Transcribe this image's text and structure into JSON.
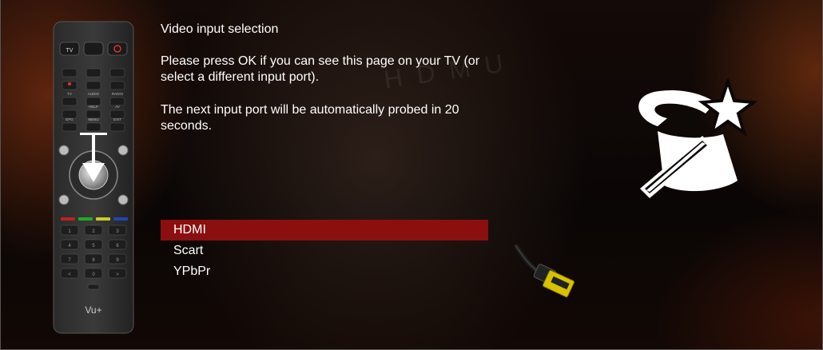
{
  "screen": {
    "title": "Video input selection",
    "description_1": "Please press OK if you can see this page on your TV (or select a different input port).",
    "description_2": "The next input port will be automatically probed in 20 seconds."
  },
  "menu": {
    "items": [
      {
        "label": "HDMI",
        "selected": true
      },
      {
        "label": "Scart",
        "selected": false
      },
      {
        "label": "YPbPr",
        "selected": false
      }
    ]
  },
  "remote": {
    "brand": "Vu+",
    "buttons": {
      "tv": "TV",
      "tv2": "TV",
      "audio": "AUDIO",
      "radio": "RADIO",
      "help": "HELP",
      "av": "AV",
      "epg": "EPG",
      "menu": "MENU",
      "exit": "EXIT"
    }
  },
  "icons": {
    "wizard": "magic-hat-wand-icon",
    "cable": "hdmi-cable-icon"
  },
  "colors": {
    "selected_bg": "#8b0f0f",
    "text": "#ffffff",
    "background": "#0b0706"
  }
}
